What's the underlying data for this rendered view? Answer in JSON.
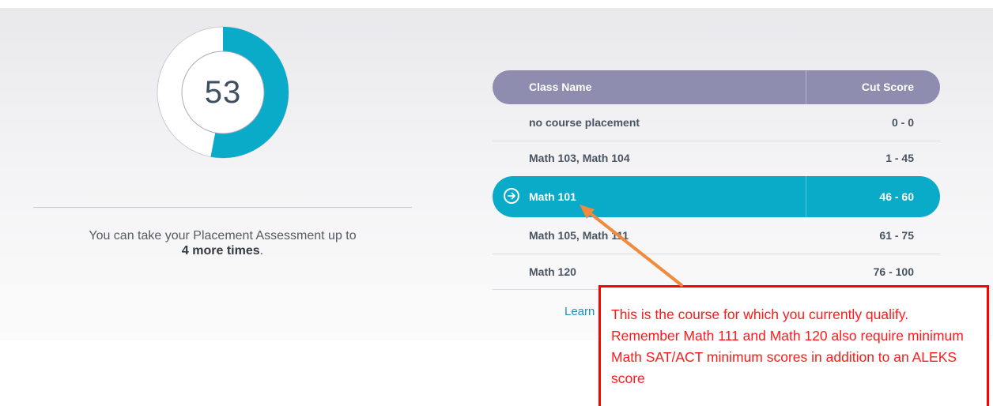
{
  "score": {
    "value": "53",
    "percent": 53,
    "fill_color": "#0aaac9",
    "track_color": "#ffffff"
  },
  "attempts_message": {
    "prefix": "You can take your Placement Assessment up to",
    "emphasis": "4 more times",
    "suffix": "."
  },
  "table": {
    "headers": {
      "class_name": "Class Name",
      "cut_score": "Cut Score"
    },
    "rows": [
      {
        "name": "no course placement",
        "cut": "0 - 0"
      },
      {
        "name": "Math 103, Math 104",
        "cut": "1 - 45"
      },
      {
        "name": "Math 101",
        "cut": "46 - 60",
        "current": true,
        "icon": "arrow-right-circle-icon"
      },
      {
        "name": "Math 105, Math 111",
        "cut": "61 - 75"
      },
      {
        "name": "Math 120",
        "cut": "76 - 100"
      }
    ],
    "header_color": "#8e8db0",
    "highlight_color": "#0aaac9"
  },
  "learn_link": "Learn",
  "annotation": {
    "text": "This is the course for which you currently qualify. Remember Math 111 and Math 120 also require minimum Math SAT/ACT minimum scores in addition to an ALEKS score",
    "border_color": "#ff0000",
    "arrow_color": "#f08a3c"
  }
}
